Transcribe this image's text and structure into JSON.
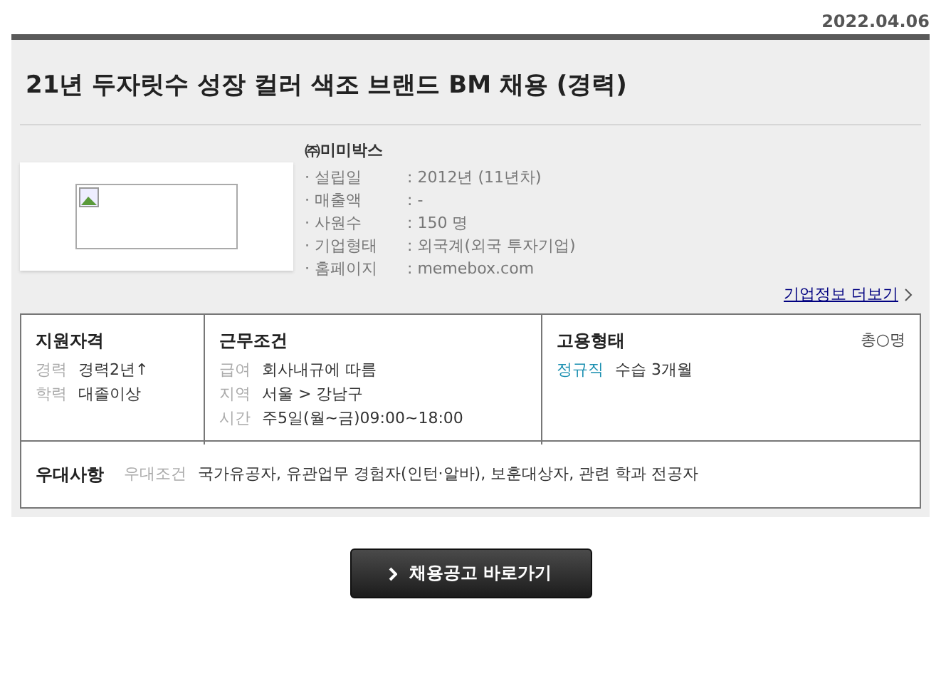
{
  "date": "2022.04.06",
  "title": "21년 두자릿수 성장 컬러 색조 브랜드 BM 채용 (경력)",
  "company": {
    "name": "㈜미미박스",
    "logo": {
      "kind": "broken-image"
    },
    "facts": [
      {
        "label": "· 설립일",
        "value": ": 2012년 (11년차)"
      },
      {
        "label": "· 매출액",
        "value": ": -"
      },
      {
        "label": "· 사원수",
        "value": ": 150 명"
      },
      {
        "label": "· 기업형태",
        "value": ": 외국계(외국 투자기업)"
      },
      {
        "label": "· 홈페이지",
        "value": ": memebox.com"
      }
    ],
    "more_link": "기업정보 더보기"
  },
  "sections": [
    {
      "heading": "지원자격",
      "rows": [
        {
          "label": "경력",
          "value": "경력2년↑"
        },
        {
          "label": "학력",
          "value": "대졸이상"
        }
      ]
    },
    {
      "heading": "근무조건",
      "rows": [
        {
          "label": "급여",
          "value": "회사내규에 따름"
        },
        {
          "label": "지역",
          "value": "서울 > 강남구"
        },
        {
          "label": "시간",
          "value": "주5일(월~금)09:00~18:00"
        }
      ]
    },
    {
      "heading": "고용형태",
      "count": "총○명",
      "employment": {
        "type": "정규직",
        "note": "수습 3개월"
      }
    }
  ],
  "preference": {
    "heading": "우대사항",
    "label": "우대조건",
    "value": "국가유공자, 유관업무 경험자(인턴·알바), 보훈대상자, 관련 학과 전공자"
  },
  "apply_button": "채용공고 바로가기"
}
